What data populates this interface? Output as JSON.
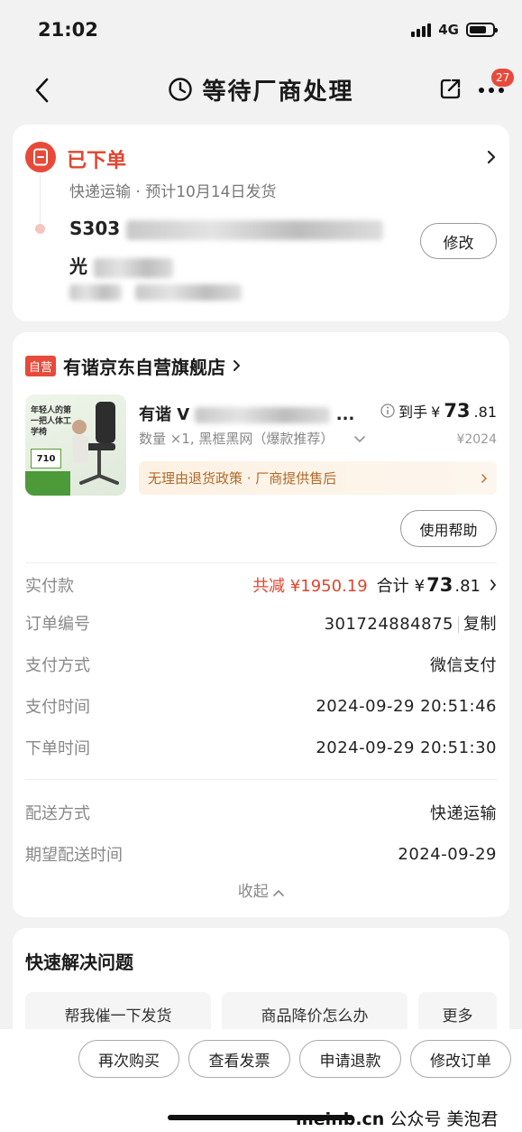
{
  "status_bar": {
    "time": "21:02",
    "network": "4G"
  },
  "nav": {
    "title": "等待厂商处理",
    "badge_count": "27"
  },
  "order_status": {
    "title": "已下单",
    "subtitle": "快递运输 · 预计10月14日发货",
    "address_line1": "S303",
    "address_line2": "光",
    "modify_label": "修改"
  },
  "shop": {
    "tag": "自营",
    "name": "有谐京东自营旗舰店"
  },
  "product": {
    "thumb_text": "年轻人的第一把人体工学椅",
    "thumb_badge": "710",
    "title": "有谐 V",
    "spec": "数量 ×1, 黑框黑网（爆款推荐）",
    "price_label": "到手",
    "price_prefix": "¥",
    "price_int": "73",
    "price_dec": ".81",
    "orig_price": "¥2024",
    "policy": "无理由退货政策 · 厂商提供售后",
    "help_label": "使用帮助"
  },
  "payment": {
    "paid_label": "实付款",
    "saved": "共减 ¥1950.19",
    "total_label": "合计",
    "total_prefix": "¥",
    "total_int": "73",
    "total_dec": ".81",
    "order_no_label": "订单编号",
    "order_no": "301724884875",
    "copy_label": "复制",
    "pay_method_label": "支付方式",
    "pay_method": "微信支付",
    "pay_time_label": "支付时间",
    "pay_time": "2024-09-29 20:51:46",
    "order_time_label": "下单时间",
    "order_time": "2024-09-29 20:51:30",
    "delivery_label": "配送方式",
    "delivery": "快递运输",
    "expect_label": "期望配送时间",
    "expect_date": "2024-09-29",
    "collapse_label": "收起"
  },
  "quick": {
    "title": "快速解决问题",
    "chips": [
      "帮我催一下发货",
      "商品降价怎么办",
      "更多"
    ]
  },
  "actions": [
    "再次购买",
    "查看发票",
    "申请退款",
    "修改订单"
  ],
  "watermark": {
    "site": "meinb.cn",
    "account": "公众号 美泡君"
  },
  "colors": {
    "accent": "#e84a3a",
    "policy_text": "#b06a2a"
  }
}
